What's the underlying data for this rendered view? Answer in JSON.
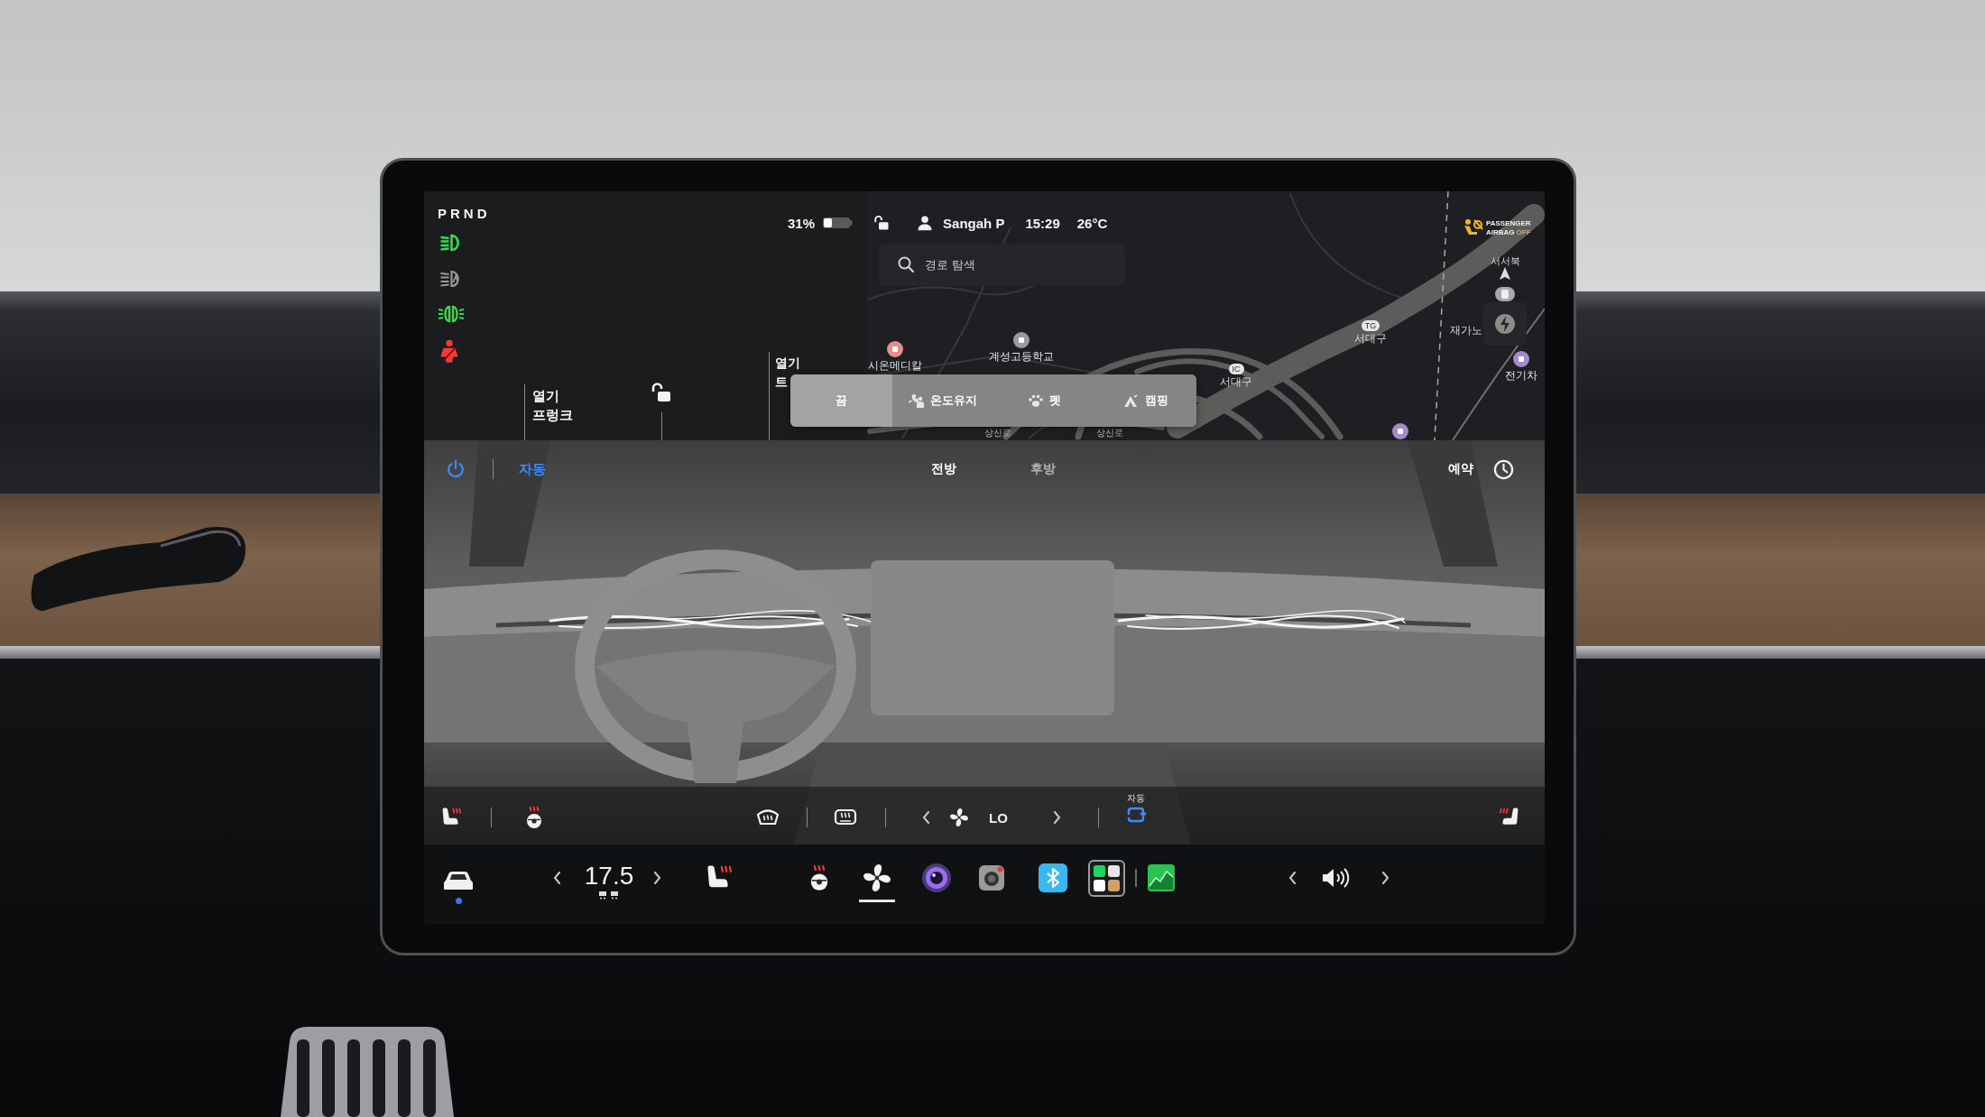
{
  "gear": "PRND",
  "indicators": [
    {
      "kind": "headlights",
      "color": "#37d94e"
    },
    {
      "kind": "auto_headlights",
      "color": "#9a9a9a"
    },
    {
      "kind": "parking_lights",
      "color": "#37d94e"
    },
    {
      "kind": "seatbelt_warning",
      "color": "#f23b3b"
    }
  ],
  "status_bar": {
    "battery": "31%",
    "locked": false,
    "driver": "Sangah P",
    "time": "15:29",
    "temperature": "26°C"
  },
  "search": {
    "placeholder": "경로 탐색"
  },
  "passenger_airbag": {
    "line_1": "PASSENGER",
    "line_2": "AIRBAG",
    "status": "OFF"
  },
  "frunk": {
    "action": "열기",
    "label": "프렁크"
  },
  "door_lock": {
    "locked": false
  },
  "trunk": {
    "action": "열기",
    "label": "트"
  },
  "cabin_modes": [
    {
      "kind": "off",
      "label": "끔",
      "selected": true
    },
    {
      "kind": "keep",
      "label": "온도유지",
      "selected": false
    },
    {
      "kind": "pet",
      "label": "펫",
      "selected": false
    },
    {
      "kind": "camp",
      "label": "캠핑",
      "selected": false
    }
  ],
  "map": {
    "heading": "서서북",
    "labels": [
      {
        "kind": "poi",
        "text": "시온메디칼",
        "color": "#e98c8c"
      },
      {
        "kind": "poi",
        "text": "계성고등학교",
        "color": "#9a9a9a"
      },
      {
        "kind": "place",
        "text": "서대구",
        "badge": "TG"
      },
      {
        "kind": "place",
        "text": "서대구",
        "badge": "IC"
      },
      {
        "kind": "place",
        "text": "재가노"
      },
      {
        "kind": "poi",
        "text": "전기차",
        "color": "#a58ad0"
      },
      {
        "kind": "road",
        "text": "상신로"
      },
      {
        "kind": "road",
        "text": "상신로"
      },
      {
        "kind": "pin",
        "color": "#a58ad0"
      }
    ]
  },
  "climate": {
    "power_on": true,
    "auto": {
      "label": "자동",
      "on": true
    },
    "zones": [
      {
        "label": "전방",
        "selected": true
      },
      {
        "label": "후방",
        "selected": false
      }
    ],
    "schedule": "예약",
    "controls": [
      {
        "kind": "seat_heater_left",
        "on": true
      },
      {
        "kind": "steering_heater",
        "on": true
      },
      {
        "kind": "front_defrost",
        "on": false
      },
      {
        "kind": "rear_defrost",
        "on": false
      },
      {
        "kind": "fan",
        "speed": "LO"
      },
      {
        "kind": "recirculation",
        "label": "자동",
        "on": true
      },
      {
        "kind": "seat_heater_right",
        "on": true
      }
    ]
  },
  "taskbar": {
    "car": {
      "notification": true
    },
    "temperature": "17.5",
    "heaters": [
      {
        "kind": "seat_heater",
        "on": true
      },
      {
        "kind": "steering_heater",
        "on": true
      }
    ],
    "apps": [
      {
        "kind": "climate",
        "selected": true
      },
      {
        "kind": "camera",
        "selected": false
      },
      {
        "kind": "dashcam",
        "selected": false
      },
      {
        "kind": "bluetooth",
        "selected": false
      },
      {
        "kind": "launcher",
        "selected": false
      },
      {
        "kind": "energy",
        "selected": false
      }
    ]
  }
}
